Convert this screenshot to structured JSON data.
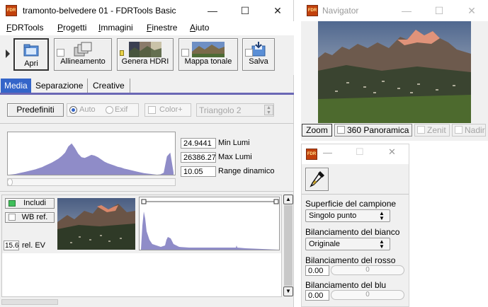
{
  "main": {
    "title": "tramonto-belvedere 01 - FDRTools Basic",
    "menu": [
      "FDRTools",
      "Progetti",
      "Immagini",
      "Finestre",
      "Aiuto"
    ],
    "toolbar": {
      "open": "Apri",
      "align": "Allineamento",
      "hdri": "Genera HDRI",
      "tonemap": "Mappa tonale",
      "save": "Salva"
    },
    "tabs": [
      "Media",
      "Separazione",
      "Creative"
    ],
    "presets_button": "Predefiniti",
    "auto_label": "Auto",
    "exif_label": "Exif",
    "color_label": "Color+",
    "triangle_select": "Triangolo 2",
    "stats": {
      "min_value": "24.9441",
      "min_label": "Min Lumi",
      "max_value": "26386.27",
      "max_label": "Max Lumi",
      "range_value": "10.05",
      "range_label": "Range dinamico"
    },
    "image_row": {
      "include_label": "Includi",
      "wb_label": "WB ref.",
      "ev_value": "15.6",
      "ev_label": "rel. EV"
    }
  },
  "navigator": {
    "title": "Navigator",
    "zoom": "Zoom",
    "panoramic": "360 Panoramica",
    "zenit": "Zenit",
    "nadir": "Nadir"
  },
  "wb_panel": {
    "sample_label": "Superficie del campione",
    "sample_value": "Singolo punto",
    "white_label": "Bilanciamento del bianco",
    "white_value": "Originale",
    "red_label": "Bilanciamento del rosso",
    "red_value": "0.00",
    "red_slider": "0",
    "blue_label": "Bilanciamento del blu",
    "blue_value": "0.00",
    "blue_slider": "0"
  },
  "colors": {
    "accent": "#8f8cc8",
    "tab_active": "#3465c9",
    "tab_underline": "#6a67b5"
  },
  "chart_data": {
    "type": "area",
    "title": "",
    "xlabel": "",
    "ylabel": "",
    "x": [
      0,
      2,
      4,
      6,
      8,
      10,
      12,
      14,
      16,
      18,
      20,
      22,
      24,
      26,
      28,
      30,
      32,
      34,
      36,
      38,
      40,
      42,
      44,
      46,
      48,
      50,
      52,
      54,
      56,
      58,
      60,
      62,
      64,
      66,
      68,
      70,
      72,
      74,
      76,
      78,
      80,
      82,
      84,
      86,
      88,
      90,
      92,
      94,
      96,
      98,
      100
    ],
    "values": [
      0,
      1,
      2,
      4,
      6,
      8,
      10,
      12,
      14,
      17,
      20,
      24,
      28,
      32,
      37,
      42,
      49,
      58,
      74,
      82,
      70,
      55,
      46,
      44,
      48,
      52,
      50,
      46,
      40,
      34,
      30,
      27,
      24,
      21,
      19,
      16,
      14,
      12,
      10,
      8,
      6,
      4,
      3,
      2,
      1,
      0,
      1,
      5,
      48,
      58,
      6
    ],
    "ylim": [
      0,
      100
    ]
  }
}
